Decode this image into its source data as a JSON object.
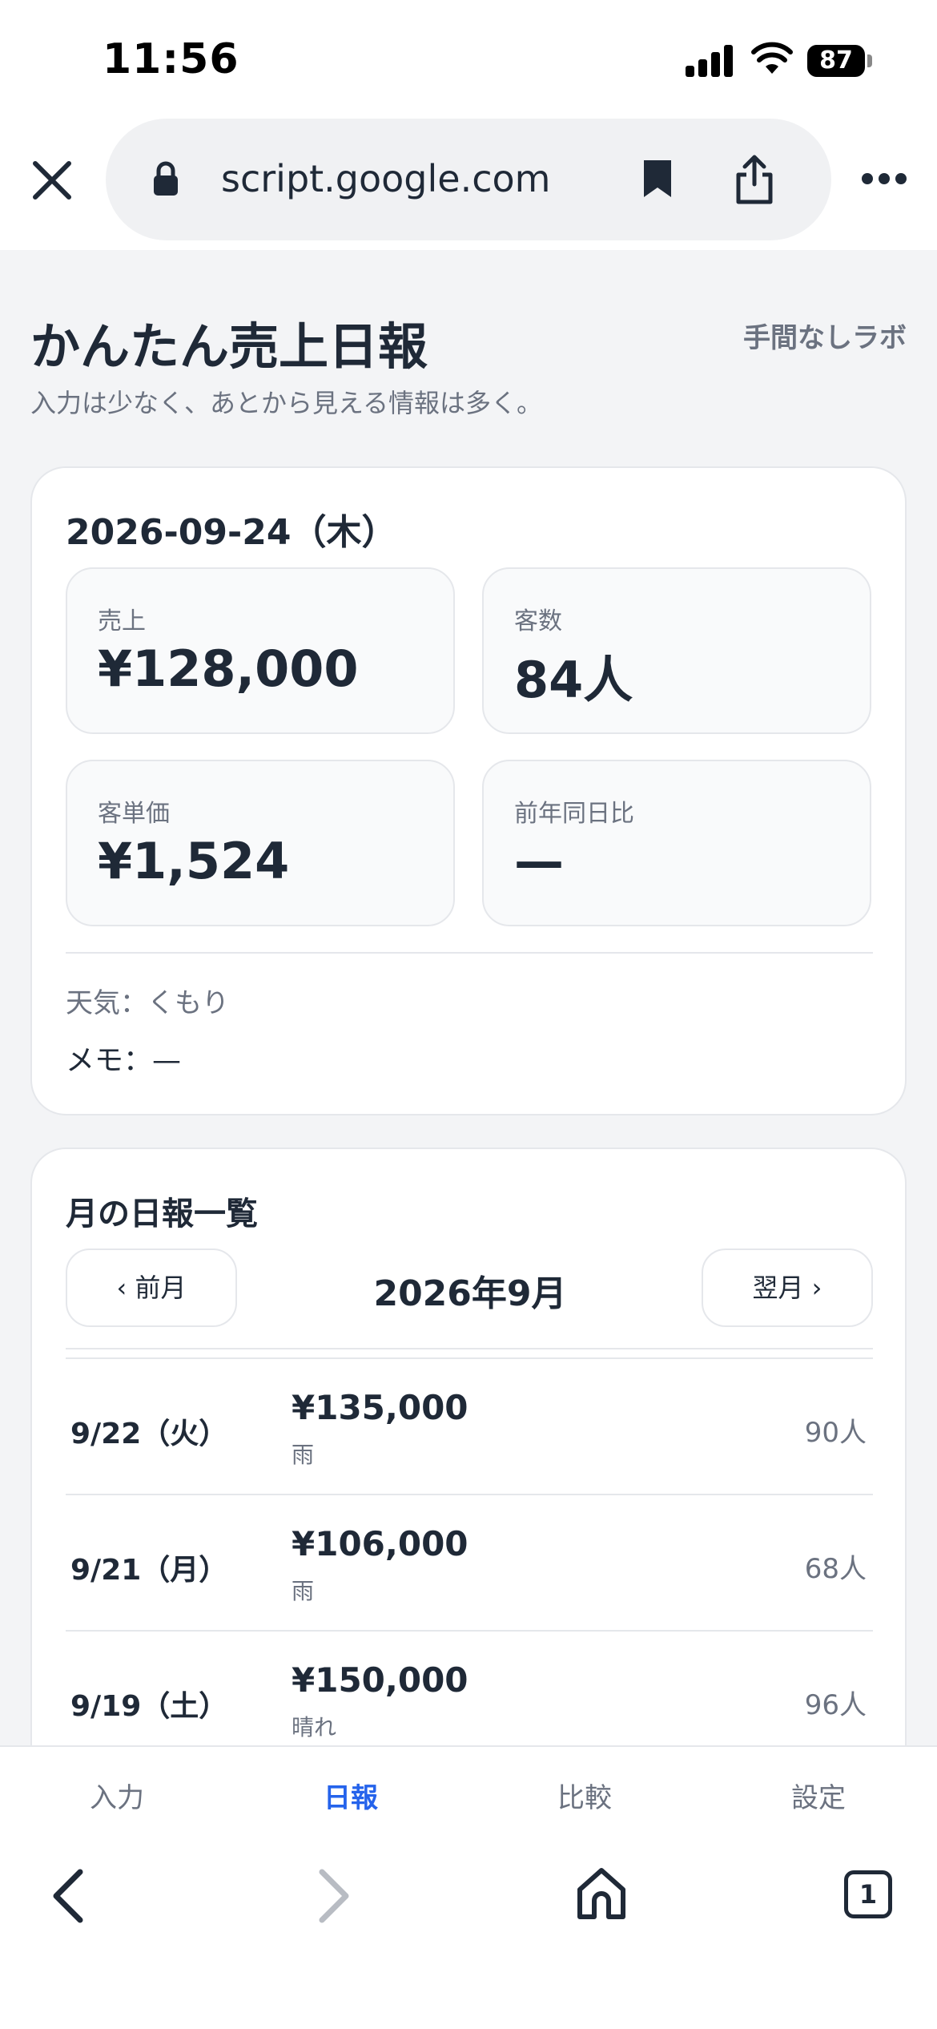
{
  "status_bar": {
    "time": "11:56",
    "battery": "87",
    "icons": [
      "signal-icon",
      "wifi-icon",
      "battery-icon"
    ]
  },
  "browser": {
    "url": "script.google.com",
    "icons": [
      "close-icon",
      "lock-icon",
      "bookmark-icon",
      "share-icon",
      "more-icon"
    ]
  },
  "header": {
    "title": "かんたん売上日報",
    "brand": "手間なしラボ",
    "subtitle": "入力は少なく、あとから見える情報は多く。"
  },
  "daily": {
    "date": "2026-09-24（木）",
    "metrics": [
      {
        "label": "売上",
        "value": "¥128,000"
      },
      {
        "label": "客数",
        "value": "84人"
      },
      {
        "label": "客単価",
        "value": "¥1,524"
      },
      {
        "label": "前年同日比",
        "value": "—"
      }
    ],
    "weather": "天気：くもり",
    "memo": "メモ：—"
  },
  "monthly": {
    "title": "月の日報一覧",
    "prev_label": "‹ 前月",
    "next_label": "翌月 ›",
    "month": "2026年9月",
    "rows": [
      {
        "date": "9/22（火）",
        "amount": "¥135,000",
        "weather": "雨",
        "count": "90人"
      },
      {
        "date": "9/21（月）",
        "amount": "¥106,000",
        "weather": "雨",
        "count": "68人"
      },
      {
        "date": "9/19（土）",
        "amount": "¥150,000",
        "weather": "晴れ",
        "count": "96人"
      }
    ]
  },
  "tabs": [
    {
      "label": "入力",
      "active": false
    },
    {
      "label": "日報",
      "active": true
    },
    {
      "label": "比較",
      "active": false
    },
    {
      "label": "設定",
      "active": false
    }
  ],
  "toolbar": {
    "tab_count": "1",
    "icons": [
      "back-icon",
      "forward-icon",
      "home-icon",
      "tabs-icon"
    ]
  },
  "colors": {
    "accent": "#2563eb",
    "page_bg": "#f3f4f6",
    "text": "#1f2937",
    "muted": "#6b7280",
    "border": "#e5e7eb"
  }
}
